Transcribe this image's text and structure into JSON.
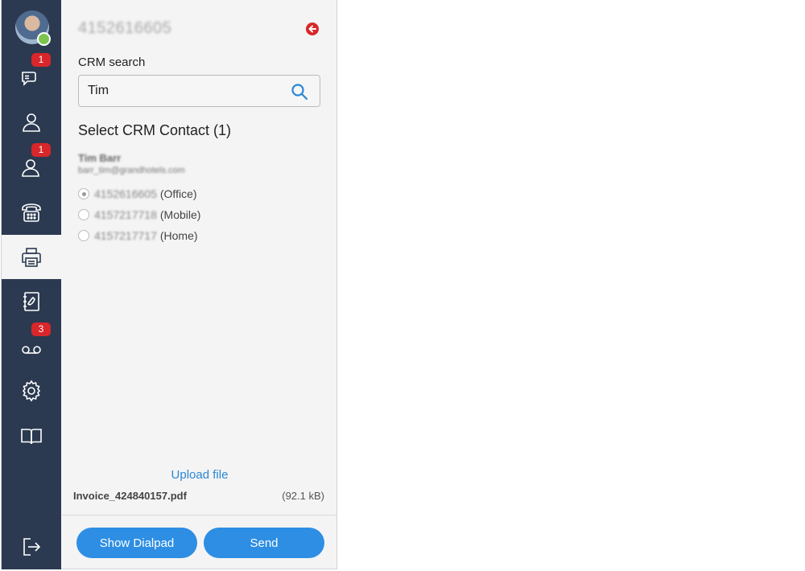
{
  "header": {
    "phone_number": "4152616605",
    "back_icon": "back-arrow-icon",
    "accent_color": "#d9262a"
  },
  "sidebar": {
    "items": [
      {
        "name": "chats",
        "icon": "chat-icon",
        "badge": "1"
      },
      {
        "name": "contacts",
        "icon": "user-icon",
        "badge": ""
      },
      {
        "name": "groups",
        "icon": "user-icon",
        "badge": "1"
      },
      {
        "name": "dialpad",
        "icon": "phone-icon",
        "badge": ""
      },
      {
        "name": "fax",
        "icon": "printer-icon",
        "badge": "",
        "active": true
      },
      {
        "name": "phonebook",
        "icon": "address-book-icon",
        "badge": ""
      },
      {
        "name": "voicemail",
        "icon": "voicemail-icon",
        "badge": "3"
      },
      {
        "name": "settings",
        "icon": "gear-icon",
        "badge": ""
      },
      {
        "name": "help",
        "icon": "book-icon",
        "badge": ""
      },
      {
        "name": "logout",
        "icon": "logout-icon",
        "badge": ""
      }
    ]
  },
  "crm": {
    "search_label": "CRM search",
    "search_value": "Tim",
    "select_title": "Select CRM Contact (1)",
    "contact": {
      "name": "Tim Barr",
      "email": "barr_tim@grandhotels.com",
      "numbers": [
        {
          "number": "4152616605",
          "type": "(Office)",
          "checked": true
        },
        {
          "number": "4157217718",
          "type": "(Mobile)",
          "checked": false
        },
        {
          "number": "4157217717",
          "type": "(Home)",
          "checked": false
        }
      ]
    }
  },
  "file": {
    "upload_label": "Upload file",
    "name": "Invoice_424840157.pdf",
    "size": "(92.1 kB)"
  },
  "actions": {
    "dialpad_label": "Show Dialpad",
    "send_label": "Send",
    "button_color": "#2d8ee4"
  }
}
